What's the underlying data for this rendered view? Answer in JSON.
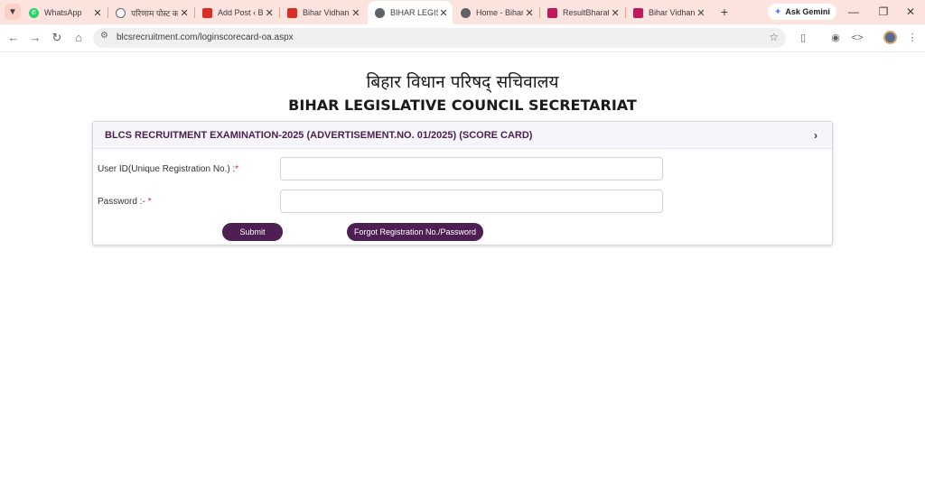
{
  "browser": {
    "tabs": [
      {
        "title": "WhatsApp",
        "favicon": "whatsapp-icon",
        "color": "#25d366",
        "active": false
      },
      {
        "title": "परिणाम पोस्ट क",
        "favicon": "settings-icon",
        "color": "#5f6368",
        "active": false
      },
      {
        "title": "Add Post ‹ Bi",
        "favicon": "site-logo-icon",
        "color": "#d93025",
        "active": false
      },
      {
        "title": "Bihar Vidhan",
        "favicon": "site-logo-icon",
        "color": "#d93025",
        "active": false
      },
      {
        "title": "BIHAR LEGISL",
        "favicon": "globe-icon",
        "color": "#5f6368",
        "active": true
      },
      {
        "title": "Home - Bihar",
        "favicon": "globe-icon",
        "color": "#5f6368",
        "active": false
      },
      {
        "title": "ResultBharat",
        "favicon": "site-logo-icon",
        "color": "#c2185b",
        "active": false
      },
      {
        "title": "Bihar Vidhan",
        "favicon": "site-logo-icon",
        "color": "#c2185b",
        "active": false
      }
    ],
    "gemini_label": "Ask Gemini",
    "url": "blcsrecruitment.com/loginscorecard-oa.aspx"
  },
  "page": {
    "title_hindi": "बिहार विधान परिषद् सचिवालय",
    "title_english": "BIHAR LEGISLATIVE COUNCIL SECRETARIAT",
    "card_header": "BLCS RECRUITMENT EXAMINATION-2025 (ADVERTISEMENT.NO. 01/2025) (SCORE CARD)",
    "userid_label": "User ID(Unique Registration No.) :",
    "password_label": "Password :- ",
    "required_mark": "*",
    "userid_value": "",
    "password_value": "",
    "submit_label": "Submit",
    "forgot_label": "Forgot Registration No./Password"
  },
  "colors": {
    "tabstrip_bg": "#fde3dd",
    "button_bg": "#4e1f52",
    "header_text": "#4a1f4f",
    "required": "#e02020"
  }
}
